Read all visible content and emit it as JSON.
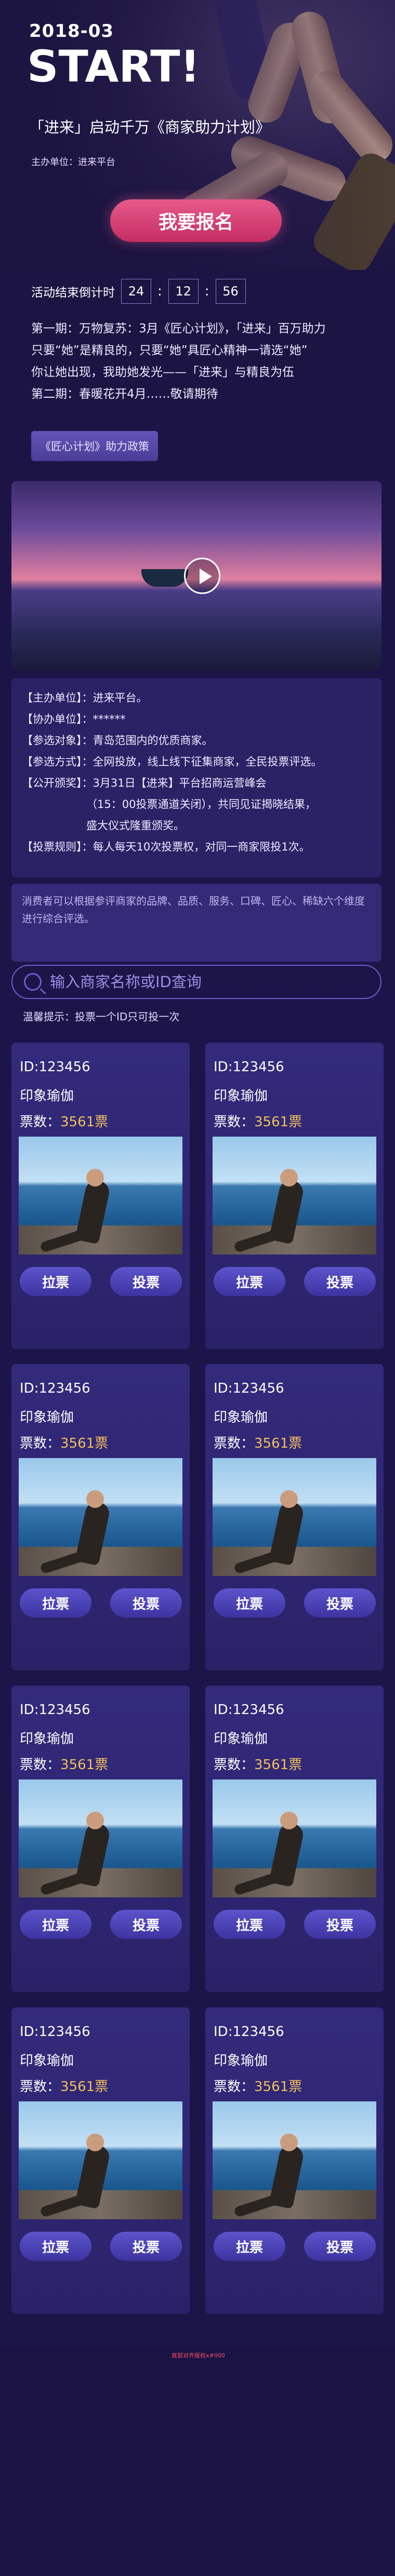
{
  "hero": {
    "year": "2018-03",
    "title": "START!",
    "slogan": "「进来」启动千万《商家助力计划》",
    "organizer": "主办单位：进来平台",
    "signup_label": "我要报名"
  },
  "countdown": {
    "label": "活动结束倒计时",
    "hours": "24",
    "minutes": "12",
    "seconds": "56",
    "separator": ":"
  },
  "intro": {
    "line1": "第一期：万物复苏：3月《匠心计划》，「进来」百万助力",
    "line2": "只要“她”是精良的，只要“她”具匠心精神一请选“她”",
    "line3": "你让她出现，我助她发光——「进来」与精良为伍",
    "line4": "第二期：春暖花开4月……敬请期待"
  },
  "policy_label": "《匠心计划》助力政策",
  "rules": {
    "host": "【主办单位】：进来平台。",
    "co_host": "【协办单位】：******",
    "participants": "【参选对象】：青岛范围内的优质商家。",
    "method": "【参选方式】：全网投放，线上线下征集商家，全民投票评选。",
    "publish1": "【公开颁奖】：3月31日【进来】平台招商运营峰会",
    "publish2": "（15：00投票通道关闭），共同见证揭晓结果，",
    "publish3": "盛大仪式隆重颁奖。",
    "vote_rule": "【投票规则】：每人每天10次投票权，对同一商家限投1次。"
  },
  "notice": "消费者可以根据参评商家的品牌、品质、服务、口碑、匠心、稀缺六个维度进行综合评选。",
  "search": {
    "placeholder": "输入商家名称或ID查询"
  },
  "tip": "温馨提示：投票一个ID只可投一次",
  "cards": [
    {
      "id": "ID:123456",
      "name": "印象瑜伽",
      "votes_label": "票数：",
      "votes": "3561票",
      "pull": "拉票",
      "vote": "投票"
    },
    {
      "id": "ID:123456",
      "name": "印象瑜伽",
      "votes_label": "票数：",
      "votes": "3561票",
      "pull": "拉票",
      "vote": "投票"
    },
    {
      "id": "ID:123456",
      "name": "印象瑜伽",
      "votes_label": "票数：",
      "votes": "3561票",
      "pull": "拉票",
      "vote": "投票"
    },
    {
      "id": "ID:123456",
      "name": "印象瑜伽",
      "votes_label": "票数：",
      "votes": "3561票",
      "pull": "拉票",
      "vote": "投票"
    },
    {
      "id": "ID:123456",
      "name": "印象瑜伽",
      "votes_label": "票数：",
      "votes": "3561票",
      "pull": "拉票",
      "vote": "投票"
    },
    {
      "id": "ID:123456",
      "name": "印象瑜伽",
      "votes_label": "票数：",
      "votes": "3561票",
      "pull": "拉票",
      "vote": "投票"
    },
    {
      "id": "ID:123456",
      "name": "印象瑜伽",
      "votes_label": "票数：",
      "votes": "3561票",
      "pull": "拉票",
      "vote": "投票"
    },
    {
      "id": "ID:123456",
      "name": "印象瑜伽",
      "votes_label": "票数：",
      "votes": "3561票",
      "pull": "拉票",
      "vote": "投票"
    }
  ],
  "footer_note": "底部对齐版权x#000",
  "colors": {
    "background": "#1d1549",
    "signup_button": "#d63f73",
    "vote_count": "#f3c05a",
    "card": "#2f2774",
    "button": "#4b42b8"
  }
}
